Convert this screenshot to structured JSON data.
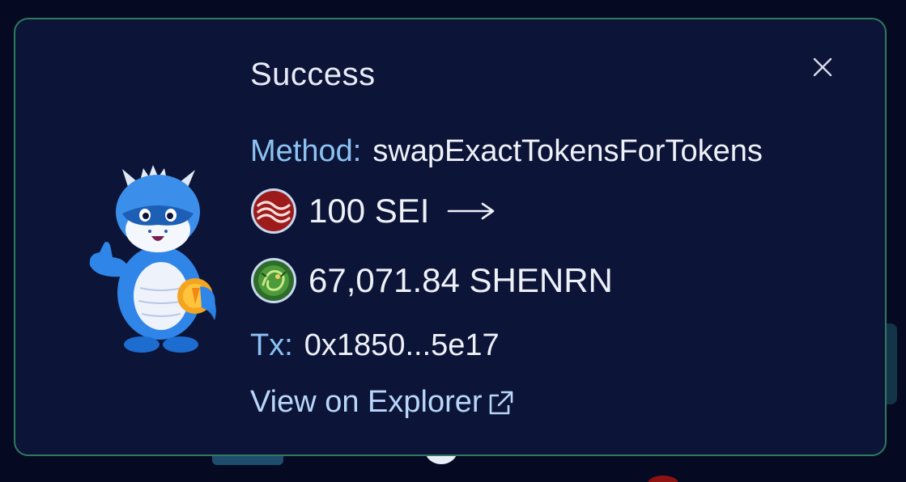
{
  "toast": {
    "title": "Success",
    "method_label": "Method:",
    "method_value": "swapExactTokensForTokens",
    "from_amount": "100 SEI",
    "to_amount": "67,071.84 SHENRN",
    "tx_label": "Tx:",
    "tx_value": "0x1850...5e17",
    "explorer_link": "View on Explorer"
  },
  "icons": {
    "close": "close-icon",
    "from_token": "sei-token-icon",
    "to_token": "shenrn-token-icon",
    "arrow": "arrow-right-icon",
    "external": "external-link-icon",
    "mascot": "dragon-mascot"
  },
  "colors": {
    "background": "#050a22",
    "toast_bg": "#0c1538",
    "toast_border": "#2f7a5e",
    "label_blue": "#8cc2f2",
    "link_blue": "#b9d6fb",
    "text": "#eef1f8"
  }
}
